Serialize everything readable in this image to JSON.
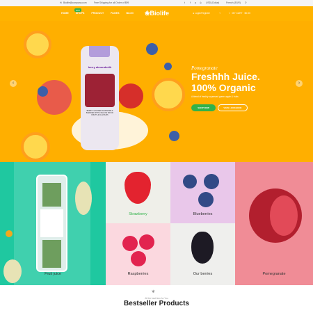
{
  "topbar": {
    "email": "Biolife@company.com",
    "shipping": "Free Shipping for all Order of $99",
    "currency": "USD (Dollar)",
    "language": "French (EUR)"
  },
  "header": {
    "logo": "Biolife",
    "hot_badge": "HOT",
    "nav": [
      "HOME",
      "SHOPS",
      "PRODUCT",
      "PAGES",
      "BLOG"
    ],
    "login": "Login/Register",
    "cart_label": "MY CART",
    "cart_total": "$0.00"
  },
  "hero": {
    "tagline": "Pomegranate",
    "title_line1": "Freshhh Juice.",
    "title_line2": "100% Organic",
    "subtitle": "A blend of freshly squeezed green apple & fruits",
    "btn_shop": "SHOP NOW",
    "btn_view": "VIEW LOOKBOOK",
    "bottle_label": "berry almondmilk",
    "bottle_text": "BERRY FLAVORED ALMONDMILK BLENDED WITH A DELUXE MIX OF FRUITS & FLAVOURS",
    "prev_icon": "‹",
    "next_icon": "›"
  },
  "categories": [
    {
      "label": "Fruit juice"
    },
    {
      "label": "Strawberry"
    },
    {
      "label": "Blueberries"
    },
    {
      "label": "Pomegranate"
    },
    {
      "label": "Raspberries"
    },
    {
      "label": "Our berries"
    }
  ],
  "bestseller": {
    "small": "All the best item for You",
    "title": "Bestseller Products"
  },
  "colors": {
    "brand": "#ffb300",
    "green": "#31b24a"
  }
}
